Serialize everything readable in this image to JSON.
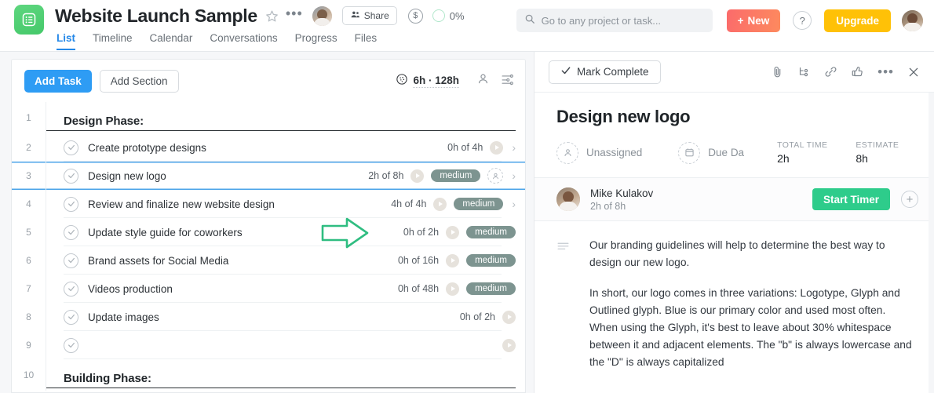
{
  "header": {
    "logo_icon": "list-board-icon",
    "project_title": "Website Launch Sample",
    "star_icon": "star-icon",
    "more_icon": "ellipsis-icon",
    "member_avatar": "member-avatar",
    "share_label": "Share",
    "share_icon": "people-icon",
    "budget_icon": "dollar-circle-icon",
    "progress_label": "0%",
    "tabs": [
      {
        "label": "List",
        "active": true
      },
      {
        "label": "Timeline",
        "active": false
      },
      {
        "label": "Calendar",
        "active": false
      },
      {
        "label": "Conversations",
        "active": false
      },
      {
        "label": "Progress",
        "active": false
      },
      {
        "label": "Files",
        "active": false
      }
    ],
    "search_placeholder": "Go to any project or task...",
    "search_value": "",
    "search_icon": "search-icon",
    "new_label": "New",
    "new_icon": "plus-icon",
    "help_label": "?",
    "upgrade_label": "Upgrade",
    "user_avatar": "user-avatar"
  },
  "list_toolbar": {
    "add_task_label": "Add Task",
    "add_section_label": "Add Section",
    "time_icon": "time-tracking-icon",
    "time_summary": "6h · 128h",
    "assignee_filter_icon": "person-icon",
    "settings_icon": "sliders-icon"
  },
  "list": {
    "rows": [
      {
        "num": "1",
        "type": "section",
        "title": "Design Phase:"
      },
      {
        "num": "2",
        "type": "task",
        "name": "Create prototype designs",
        "hours": "0h of 4h",
        "priority": "",
        "has_play": true,
        "has_chevron": true,
        "has_assignee": false
      },
      {
        "num": "3",
        "type": "task",
        "name": "Design new logo",
        "hours": "2h of 8h",
        "priority": "medium",
        "has_play": true,
        "has_chevron": true,
        "has_assignee": true,
        "selected": true
      },
      {
        "num": "4",
        "type": "task",
        "name": "Review and finalize new website design",
        "hours": "4h of 4h",
        "priority": "medium",
        "has_play": true,
        "has_chevron": true,
        "has_assignee": false
      },
      {
        "num": "5",
        "type": "task",
        "name": "Update style guide for coworkers",
        "hours": "0h of 2h",
        "priority": "medium",
        "has_play": true,
        "has_chevron": false,
        "has_assignee": false
      },
      {
        "num": "6",
        "type": "task",
        "name": "Brand assets for Social Media",
        "hours": "0h of 16h",
        "priority": "medium",
        "has_play": true,
        "has_chevron": false,
        "has_assignee": false
      },
      {
        "num": "7",
        "type": "task",
        "name": "Videos production",
        "hours": "0h of 48h",
        "priority": "medium",
        "has_play": true,
        "has_chevron": false,
        "has_assignee": false
      },
      {
        "num": "8",
        "type": "task",
        "name": "Update images",
        "hours": "0h of 2h",
        "priority": "",
        "has_play": true,
        "has_chevron": false,
        "has_assignee": false
      },
      {
        "num": "9",
        "type": "task",
        "name": "",
        "hours": "",
        "priority": "",
        "has_play": true,
        "has_chevron": false,
        "has_assignee": false
      },
      {
        "num": "10",
        "type": "section",
        "title": "Building Phase:"
      }
    ]
  },
  "detail": {
    "mark_complete_label": "Mark Complete",
    "check_icon": "check-icon",
    "toolbar_icons": [
      "attachment-icon",
      "subtask-icon",
      "link-icon",
      "thumbs-up-icon",
      "ellipsis-icon",
      "close-icon"
    ],
    "title": "Design new logo",
    "assignee_placeholder": "Unassigned",
    "assignee_icon": "person-icon",
    "due_placeholder": "Due Da",
    "due_icon": "calendar-icon",
    "total_time_caption": "TOTAL TIME",
    "total_time_value": "2h",
    "estimate_caption": "ESTIMATE",
    "estimate_value": "8h",
    "worker_name": "Mike Kulakov",
    "worker_time": "2h of 8h",
    "worker_avatar": "mike-kulakov-avatar",
    "start_timer_label": "Start Timer",
    "add_assignee_icon": "plus-icon",
    "description_icon": "description-lines-icon",
    "description_paragraphs": [
      "Our branding guidelines will help to determine the best way to design our new logo.",
      "In short, our logo comes in three variations: Logotype, Glyph and Outlined glyph. Blue is our primary color and used most often. When using the Glyph, it's best to leave about 30% whitespace between it and adjacent elements. The \"b\" is always lowercase and the \"D\" is always capitalized"
    ]
  },
  "annotations": {
    "arrow_right_color": "#2fbd81",
    "arrow_down_color": "#2fbd81"
  },
  "colors": {
    "accent_blue": "#2e9cf4",
    "green": "#2ecc8b",
    "priority_badge": "#7d9490",
    "upgrade_yellow": "#ffc107",
    "new_red": "#fb6b6b"
  }
}
